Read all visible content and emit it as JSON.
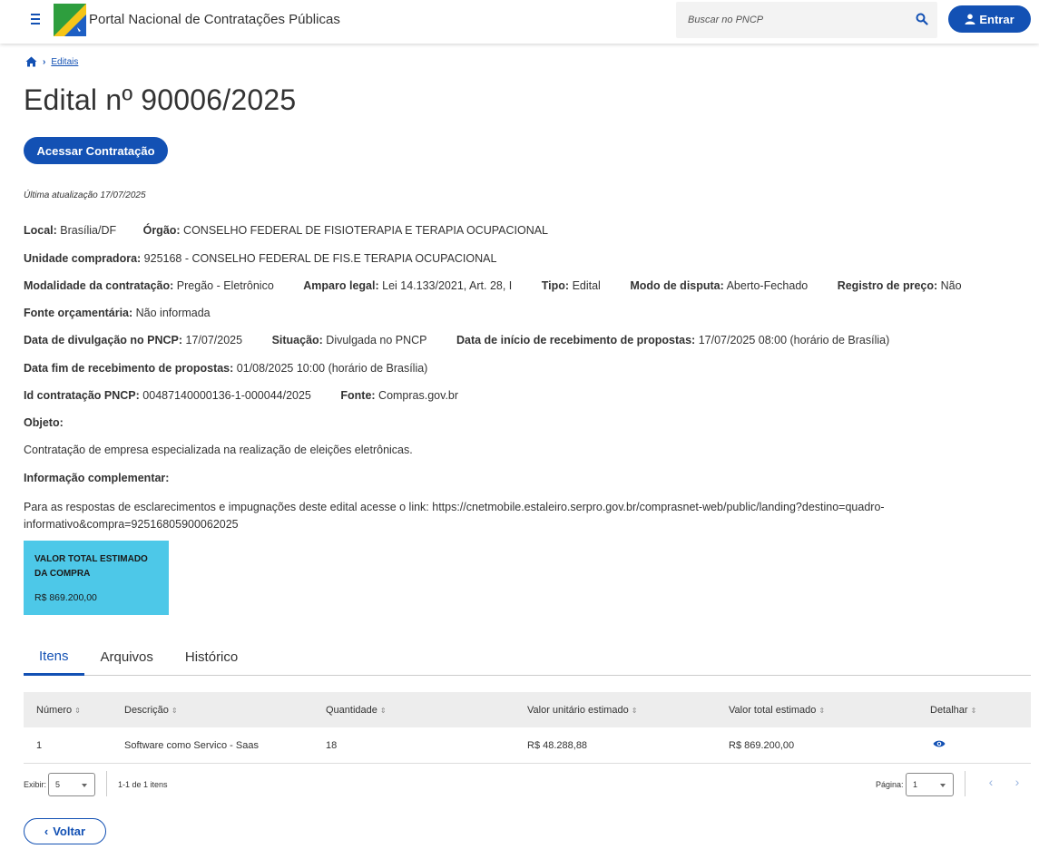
{
  "header": {
    "menu_icon": "hamburger-menu-icon",
    "logo_icon": "pncp-logo-icon",
    "title": "Portal Nacional de Contratações Públicas",
    "search_placeholder": "Buscar no PNCP",
    "search_icon": "search-icon",
    "login_label": "Entrar",
    "login_icon": "user-icon"
  },
  "breadcrumb": {
    "home_icon": "home-icon",
    "items": [
      "Editais"
    ]
  },
  "page": {
    "title": "Edital nº 90006/2025",
    "access_button": "Acessar Contratação",
    "last_update": "Última atualização 17/07/2025"
  },
  "details": {
    "local_label": "Local:",
    "local_value": " Brasília/DF",
    "orgao_label": "Órgão:",
    "orgao_value": " CONSELHO FEDERAL DE FISIOTERAPIA E TERAPIA OCUPACIONAL",
    "unidade_label": "Unidade compradora:",
    "unidade_value": " 925168 - CONSELHO FEDERAL DE FIS.E TERAPIA OCUPACIONAL",
    "modalidade_label": "Modalidade da contratação:",
    "modalidade_value": " Pregão - Eletrônico",
    "amparo_label": "Amparo legal:",
    "amparo_value": " Lei 14.133/2021, Art. 28, I",
    "tipo_label": "Tipo:",
    "tipo_value": " Edital",
    "modo_label": "Modo de disputa:",
    "modo_value": " Aberto-Fechado",
    "registro_label": "Registro de preço:",
    "registro_value": " Não",
    "fonte_orc_label": "Fonte orçamentária:",
    "fonte_orc_value": " Não informada",
    "divulgacao_label": "Data de divulgação no PNCP:",
    "divulgacao_value": " 17/07/2025",
    "situacao_label": "Situação:",
    "situacao_value": " Divulgada no PNCP",
    "inicio_label": "Data de início de recebimento de propostas:",
    "inicio_value": " 17/07/2025 08:00 (horário de Brasília)",
    "fim_label": "Data fim de recebimento de propostas:",
    "fim_value": " 01/08/2025 10:00 (horário de Brasília)",
    "id_label": "Id contratação PNCP:",
    "id_value": " 00487140000136-1-000044/2025",
    "fonte_label": "Fonte:",
    "fonte_value": " Compras.gov.br",
    "objeto_label": "Objeto:",
    "objeto_value": "Contratação de empresa especializada na realização de eleições eletrônicas.",
    "complementar_label": "Informação complementar:",
    "complementar_value": "Para as respostas de esclarecimentos e impugnações deste edital acesse o link: https://cnetmobile.estaleiro.serpro.gov.br/comprasnet-web/public/landing?destino=quadro-informativo&compra=92516805900062025"
  },
  "value_card": {
    "title": "VALOR TOTAL ESTIMADO DA COMPRA",
    "value": "R$ 869.200,00",
    "color": "#4dc8e8"
  },
  "tabs": [
    {
      "label": "Itens",
      "active": true
    },
    {
      "label": "Arquivos",
      "active": false
    },
    {
      "label": "Histórico",
      "active": false
    }
  ],
  "table": {
    "headers": [
      "Número",
      "Descrição",
      "Quantidade",
      "Valor unitário estimado",
      "Valor total estimado",
      "Detalhar"
    ],
    "sort_icon": "sort-icon",
    "rows": [
      {
        "numero": "1",
        "descricao": "Software como Servico - Saas",
        "quantidade": "18",
        "unitario": "R$ 48.288,88",
        "total": "R$ 869.200,00",
        "detail_icon": "eye-icon"
      }
    ]
  },
  "pagination": {
    "exibir_label": "Exibir:",
    "exibir_value": "5",
    "range": "1-1 de 1 itens",
    "pagina_label": "Página:",
    "pagina_value": "1",
    "prev_icon": "chevron-left-icon",
    "next_icon": "chevron-right-icon"
  },
  "back_button": {
    "label": "Voltar",
    "icon": "chevron-left-icon"
  },
  "colors": {
    "primary": "#1351b4",
    "card": "#4dc8e8",
    "table_header": "#ededed"
  }
}
